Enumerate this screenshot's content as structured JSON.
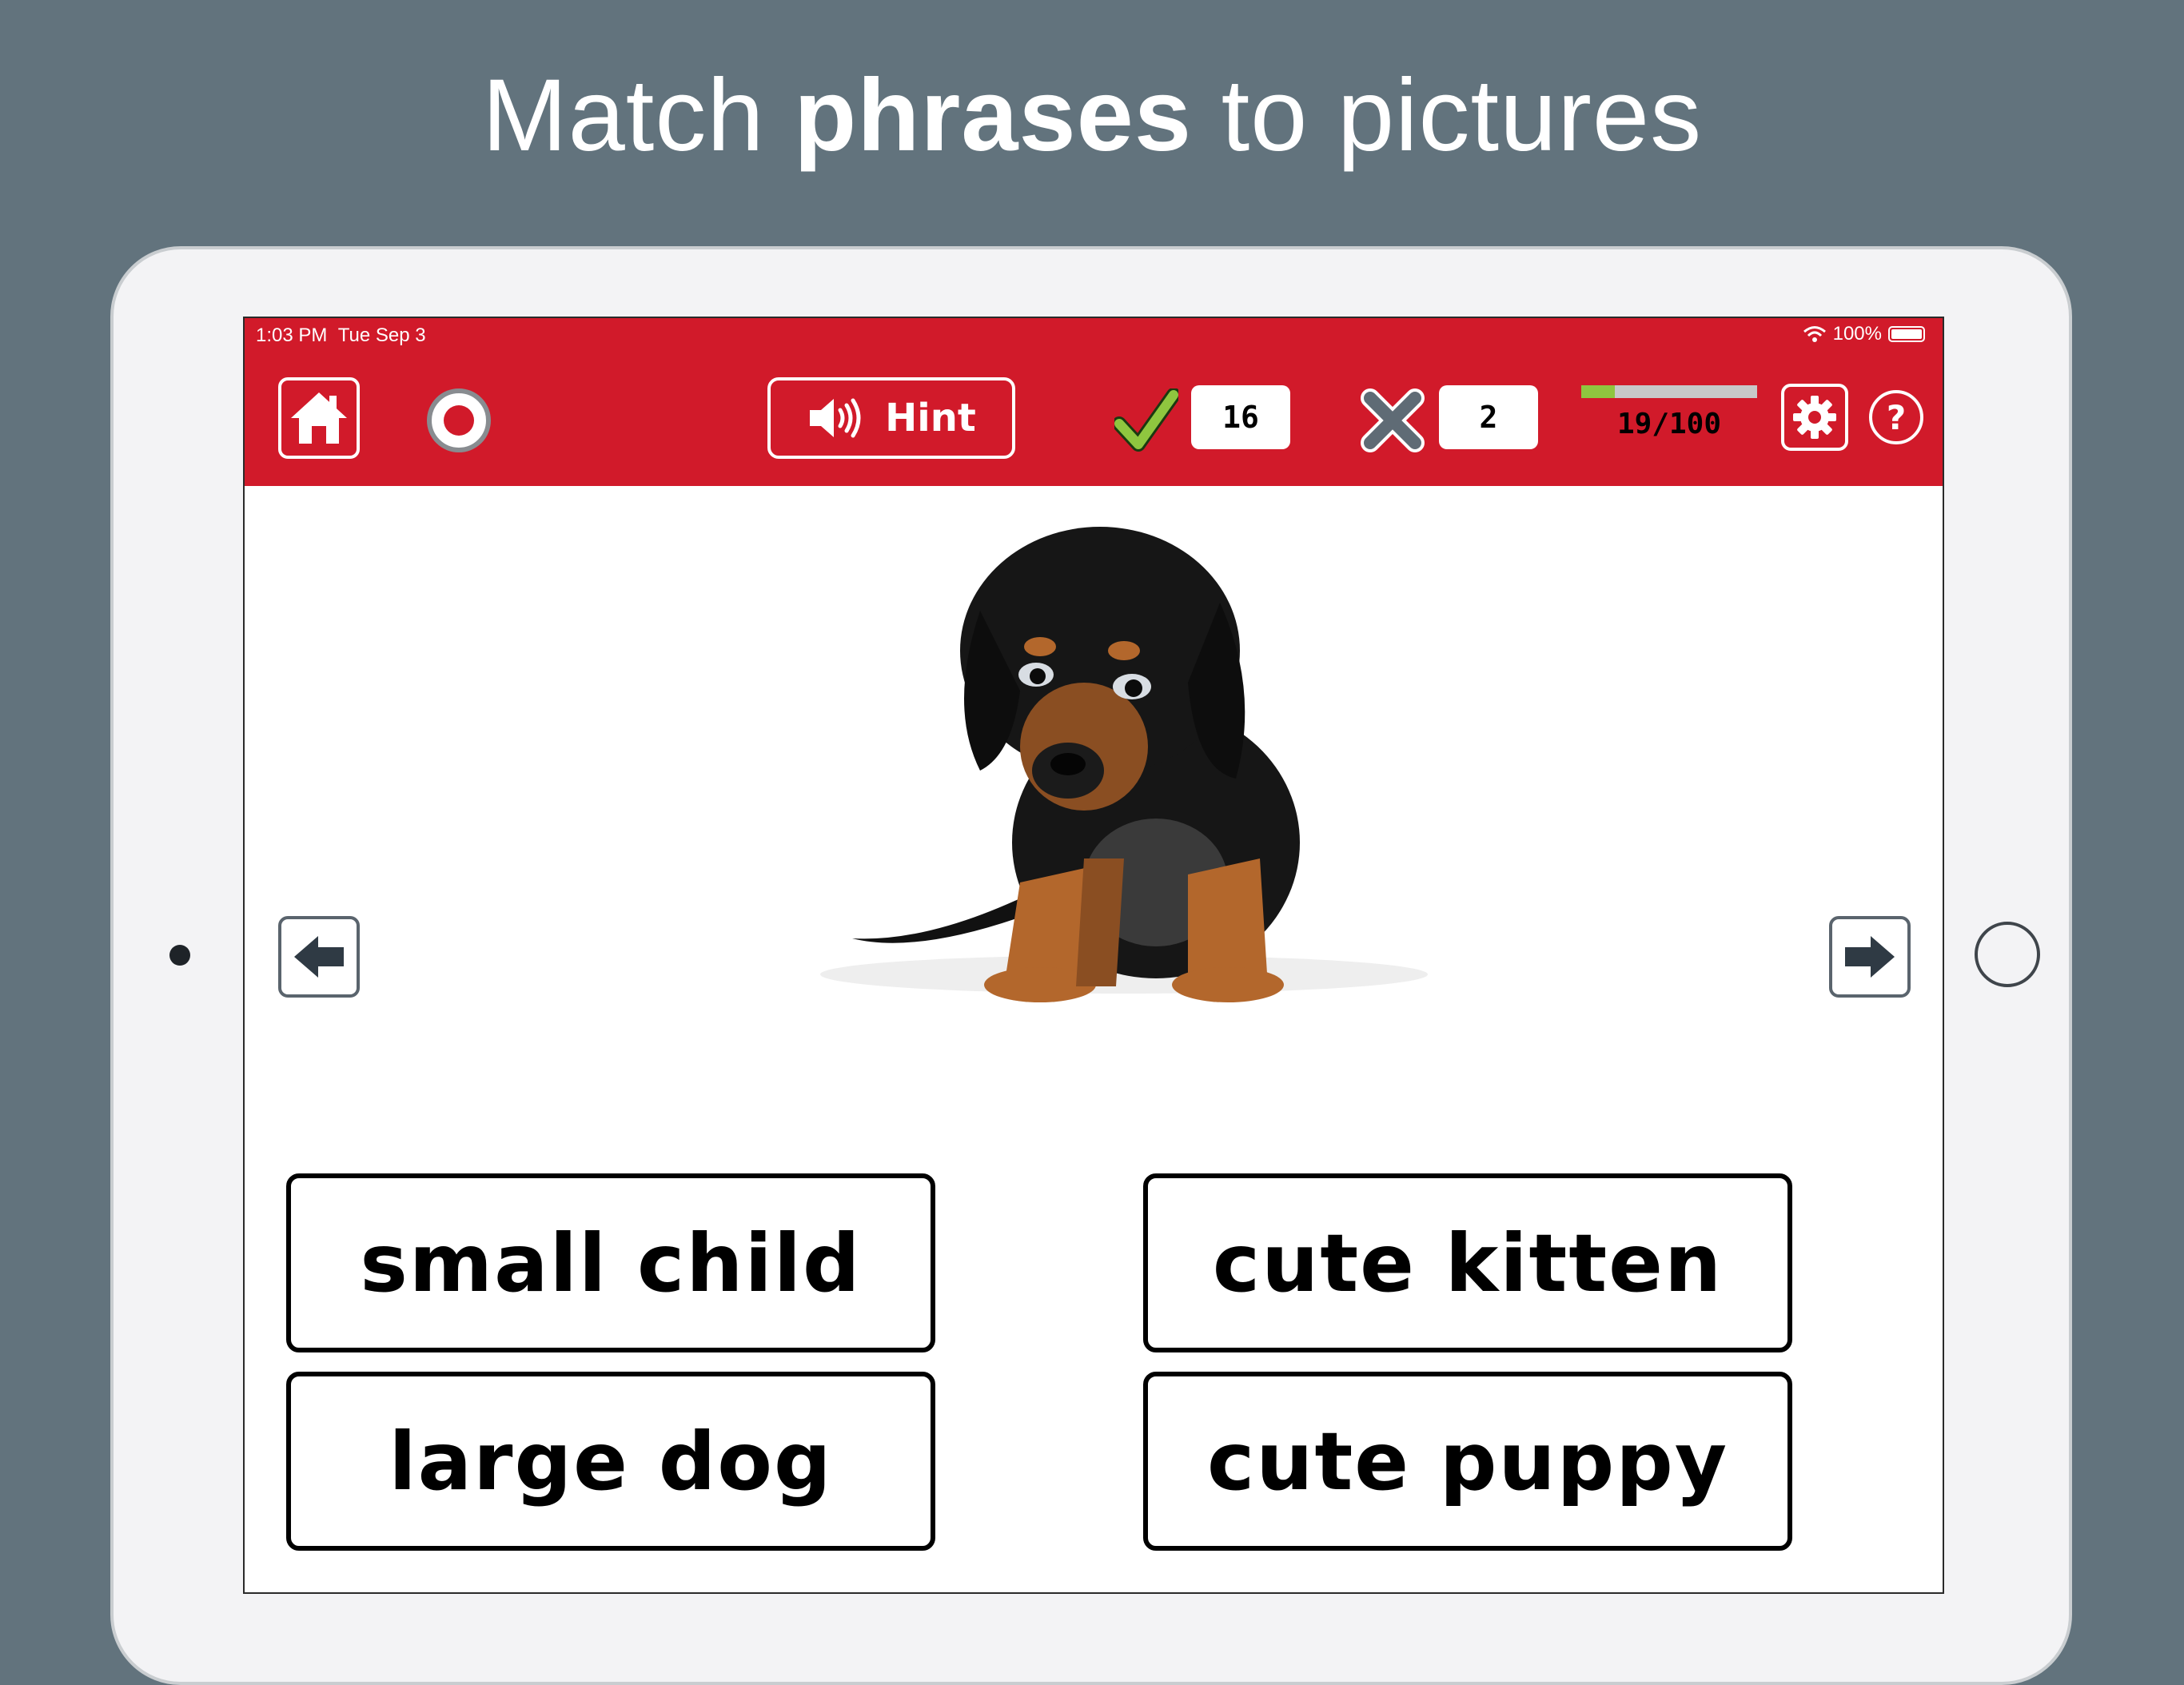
{
  "headline": {
    "pre": "Match ",
    "bold": "phrases",
    "post": " to pictures"
  },
  "status_bar": {
    "time": "1:03 PM",
    "date": "Tue Sep 3",
    "battery": "100%"
  },
  "toolbar": {
    "hint_label": "Hint",
    "correct_count": "16",
    "wrong_count": "2",
    "progress": {
      "text": "19/100",
      "fraction": 0.19
    }
  },
  "picture": {
    "subject": "dachshund puppy"
  },
  "answers": [
    "small child",
    "cute kitten",
    "large dog",
    "cute puppy"
  ],
  "icons": [
    "home-icon",
    "record-icon",
    "speaker-icon",
    "checkmark-icon",
    "x-icon",
    "gear-icon",
    "help-icon",
    "arrow-left-icon",
    "arrow-right-icon",
    "wifi-icon",
    "battery-icon"
  ],
  "colors": {
    "background": "#62737d",
    "toolbar": "#d11a2a",
    "check": "#8fc63f",
    "cross": "#5f6b75",
    "progress_track": "#c8c8c8"
  }
}
